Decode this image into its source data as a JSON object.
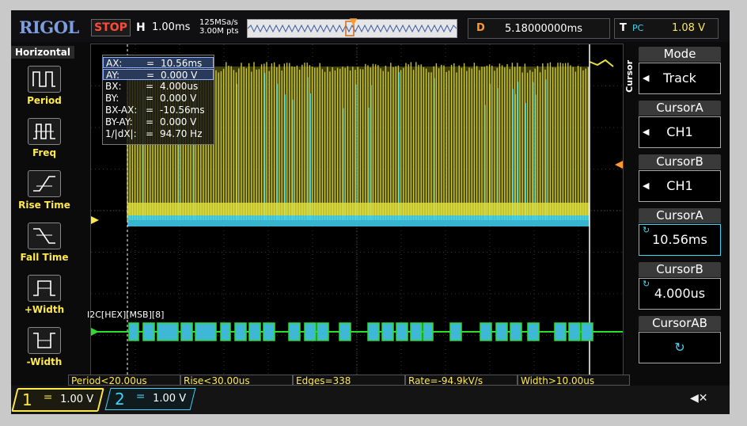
{
  "header": {
    "logo": "RIGOL",
    "run_state": "STOP",
    "h_label": "H",
    "timebase": "1.00ms",
    "sample_rate": "125MSa/s",
    "memory_depth": "3.00M pts",
    "delay_label": "D",
    "delay_value": "5.18000000ms",
    "trig_label": "T",
    "trig_source": "PC",
    "trig_level": "1.08 V"
  },
  "left_menu": {
    "title": "Horizontal",
    "items": [
      {
        "label": "Period",
        "icon": "period-icon"
      },
      {
        "label": "Freq",
        "icon": "freq-icon"
      },
      {
        "label": "Rise Time",
        "icon": "rise-time-icon"
      },
      {
        "label": "Fall Time",
        "icon": "fall-time-icon"
      },
      {
        "label": "+Width",
        "icon": "pos-width-icon"
      },
      {
        "label": "-Width",
        "icon": "neg-width-icon"
      }
    ]
  },
  "cursor_readout": {
    "rows": [
      {
        "key": "AX:",
        "value": "10.56ms",
        "selected": true
      },
      {
        "key": "AY:",
        "value": "0.000 V",
        "selected": true
      },
      {
        "key": "BX:",
        "value": "4.000us"
      },
      {
        "key": "BY:",
        "value": "0.000 V"
      },
      {
        "key": "BX-AX:",
        "value": "-10.56ms"
      },
      {
        "key": "BY-AY:",
        "value": "0.000 V"
      },
      {
        "key": "1/|dX|:",
        "value": "94.70 Hz"
      }
    ]
  },
  "decoder_label": "I2C[HEX][MSB][8]",
  "right_menu": {
    "side_label": "Cursor",
    "items": [
      {
        "title": "Mode",
        "value": "Track"
      },
      {
        "title": "CursorA",
        "value": "CH1"
      },
      {
        "title": "CursorB",
        "value": "CH1"
      },
      {
        "title": "CursorA",
        "value": "10.56ms"
      },
      {
        "title": "CursorB",
        "value": "4.000us"
      },
      {
        "title": "CursorAB",
        "value": "↻"
      }
    ]
  },
  "measurements": [
    "Period<20.00us",
    "Rise<30.00us",
    "Edges=338",
    "Rate=-94.9kV/s",
    "Width>10.00us"
  ],
  "channels": [
    {
      "num": "1",
      "scale": "1.00 V",
      "color": "#ffe94a"
    },
    {
      "num": "2",
      "scale": "1.00 V",
      "color": "#3fd4f4"
    }
  ],
  "colors": {
    "ch1": "#ffe94a",
    "ch2": "#3fd4f4",
    "decode": "#2edc2e",
    "trigger": "#ff9a2a",
    "logo": "#7d9ddf"
  }
}
